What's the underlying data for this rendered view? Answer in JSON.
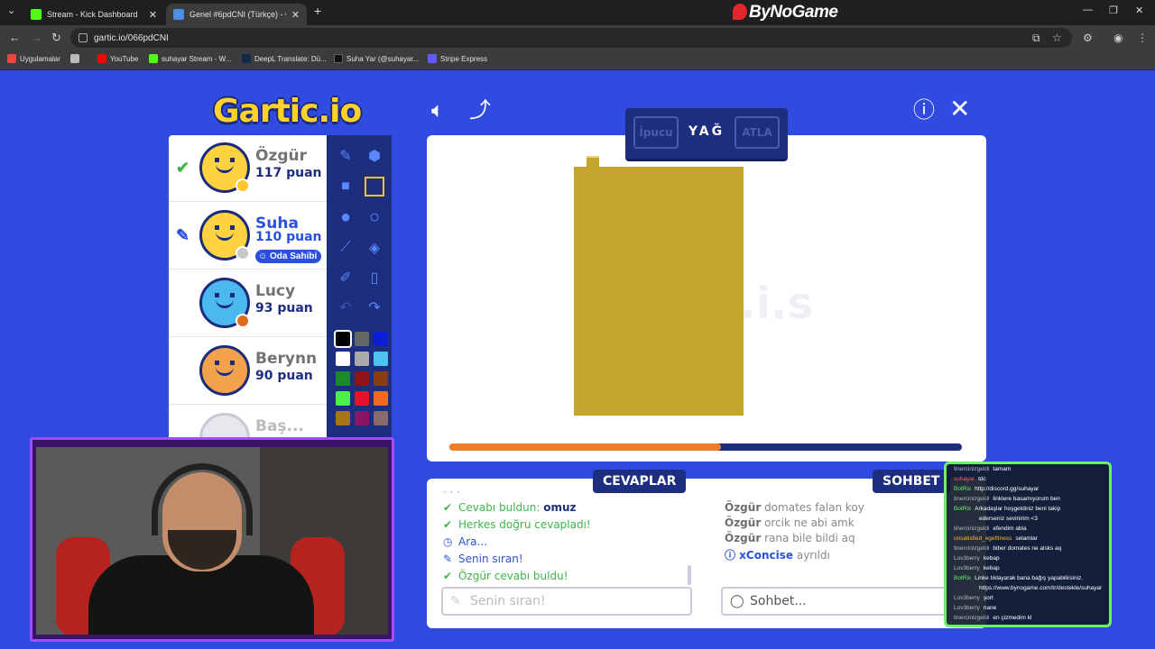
{
  "browser": {
    "tabs": [
      {
        "title": "Stream - Kick Dashboard",
        "active": false,
        "favicon_color": "#53fc18"
      },
      {
        "title": "Genel #6pdCNI (Türkçe) - Gartic.io",
        "active": true,
        "favicon_color": "#4a90e2"
      }
    ],
    "new_tab": "+",
    "brand": "ByNoGame",
    "url": "gartic.io/066pdCNI",
    "bookmarks": [
      {
        "label": "Uygulamalar",
        "color": "#e44"
      },
      {
        "label": "",
        "color": "#bbb"
      },
      {
        "label": "YouTube",
        "color": "#ff0000"
      },
      {
        "label": "suhayar Stream - W...",
        "color": "#53fc18"
      },
      {
        "label": "DeepL Translate: Dü...",
        "color": "#0f2b46"
      },
      {
        "label": "Suha Yar (@suhayar...",
        "color": "#111"
      },
      {
        "label": "Stripe Express",
        "color": "#635bff"
      }
    ]
  },
  "game": {
    "logo": "Gartic.io",
    "players": [
      {
        "name": "Özgür",
        "score": "117 puan",
        "mark": "✔",
        "mark_color": "#3db54a",
        "dot": "#ffc629",
        "current": false,
        "badge": ""
      },
      {
        "name": "Suha",
        "score": "110 puan",
        "mark": "✎",
        "mark_color": "#2b50e0",
        "dot": "#c7c7c7",
        "current": true,
        "badge": "Oda Sahibi"
      },
      {
        "name": "Lucy",
        "score": "93 puan",
        "mark": "",
        "mark_color": "",
        "dot": "#e06a1a",
        "current": false,
        "badge": ""
      },
      {
        "name": "Berynn",
        "score": "90 puan",
        "mark": "",
        "mark_color": "",
        "dot": "",
        "current": false,
        "badge": ""
      },
      {
        "name": "Baş...",
        "score": "",
        "mark": "",
        "mark_color": "",
        "dot": "",
        "current": false,
        "badge": ""
      }
    ],
    "palette": [
      "#000000",
      "#666666",
      "#0a1fd6",
      "#ffffff",
      "#aaaaaa",
      "#4cc3f0",
      "#1a8a2a",
      "#8c1616",
      "#8a3c16",
      "#4cf04c",
      "#e8102a",
      "#f06a24",
      "#a8741a",
      "#8a1466",
      "#8a6a6a"
    ],
    "word_panel": {
      "hint": "İpucu",
      "word": "YAĞ",
      "skip": "ATLA"
    },
    "progress": 0.53,
    "drawing_color": "#c5a42b",
    "answers": {
      "label": "CEVAPLAR",
      "lines": [
        {
          "icon": "✔",
          "text": "Cevabı buldun: ",
          "bold": "omuz",
          "color": "#3db54a"
        },
        {
          "icon": "✔",
          "text": "Herkes doğru cevapladı!",
          "bold": "",
          "color": "#3db54a"
        },
        {
          "icon": "◷",
          "text": "Ara...",
          "bold": "",
          "color": "#2b50e0"
        },
        {
          "icon": "✎",
          "text": "Senin sıran!",
          "bold": "",
          "color": "#2b50e0"
        },
        {
          "icon": "✔",
          "text": "Özgür cevabı buldu!",
          "bold": "",
          "color": "#3db54a"
        }
      ],
      "input_placeholder": "Senin sıran!"
    },
    "chat": {
      "label": "SOHBET",
      "lines": [
        {
          "user": "Özgür",
          "text": " domates falan koy"
        },
        {
          "user": "Özgür",
          "text": " orcik ne abi amk"
        },
        {
          "user": "Özgür",
          "text": " rana bile bildi aq"
        },
        {
          "user": "ⓘ xConcise",
          "text": " ayrıldı"
        }
      ],
      "input_placeholder": "Sohbet..."
    }
  },
  "stream_chat": [
    {
      "user": "tinercinizgeldi",
      "text": "tamam",
      "color": "#b9b9b9"
    },
    {
      "user": "suhayar",
      "text": "tdc",
      "color": "#ff5a5a"
    },
    {
      "user": "BotRix",
      "text": "http://discord.gg/suhayar",
      "color": "#6cf06a"
    },
    {
      "user": "tinercinizgeldi",
      "text": "linklere basamıyorum ben",
      "color": "#b9b9b9"
    },
    {
      "user": "BotRix",
      "text": "Arkadaşlar hoşgeldiniz beni takip",
      "color": "#6cf06a"
    },
    {
      "user": "",
      "text": "ederseniz sevinirim <3",
      "color": "#fff"
    },
    {
      "user": "tinercinizgeldi",
      "text": "efendim abla",
      "color": "#b9b9b9"
    },
    {
      "user": "unsatisfied_egefitness",
      "text": "selamlar",
      "color": "#ffb43c"
    },
    {
      "user": "tinercinizgeldi",
      "text": "biber domates ne alsks aq",
      "color": "#b9b9b9"
    },
    {
      "user": "Lov3berry",
      "text": "kebap",
      "color": "#b9b9b9"
    },
    {
      "user": "Lov3berry",
      "text": "kebap",
      "color": "#b9b9b9"
    },
    {
      "user": "BotRix",
      "text": "Linke tıklayarak bana bağış yapabilirsiniz.",
      "color": "#6cf06a"
    },
    {
      "user": "",
      "text": "https://www.bynogame.com/tr/destekle/suhayar",
      "color": "#fff"
    },
    {
      "user": "Lov3berry",
      "text": "şort",
      "color": "#b9b9b9"
    },
    {
      "user": "Lov3berry",
      "text": "nane",
      "color": "#b9b9b9"
    },
    {
      "user": "tinercinizgeldi",
      "text": "en çizmedim kl",
      "color": "#b9b9b9"
    }
  ]
}
